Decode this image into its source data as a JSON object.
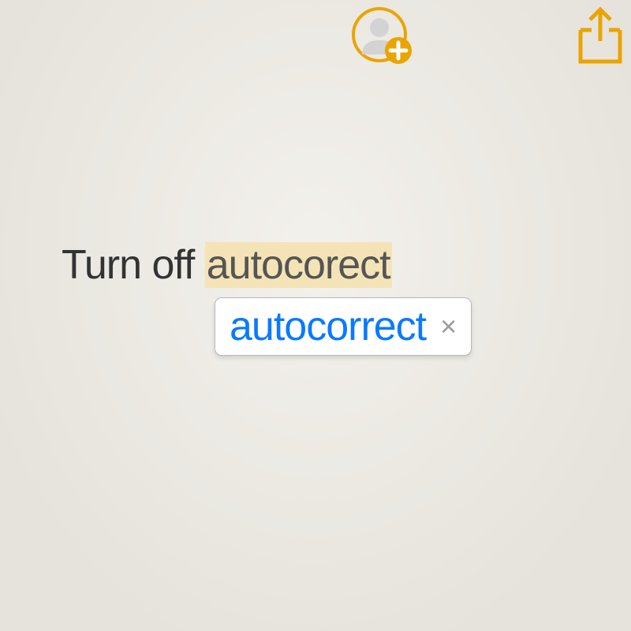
{
  "toolbar": {
    "add_person_label": "Add Person",
    "share_label": "Share"
  },
  "note": {
    "prefix": "Turn off ",
    "highlighted": "autocorect"
  },
  "suggestion": {
    "text": "autocorrect",
    "dismiss_glyph": "×"
  },
  "colors": {
    "accent": "#eaa400",
    "link": "#0a7aff",
    "highlight": "#f3e3b6"
  }
}
